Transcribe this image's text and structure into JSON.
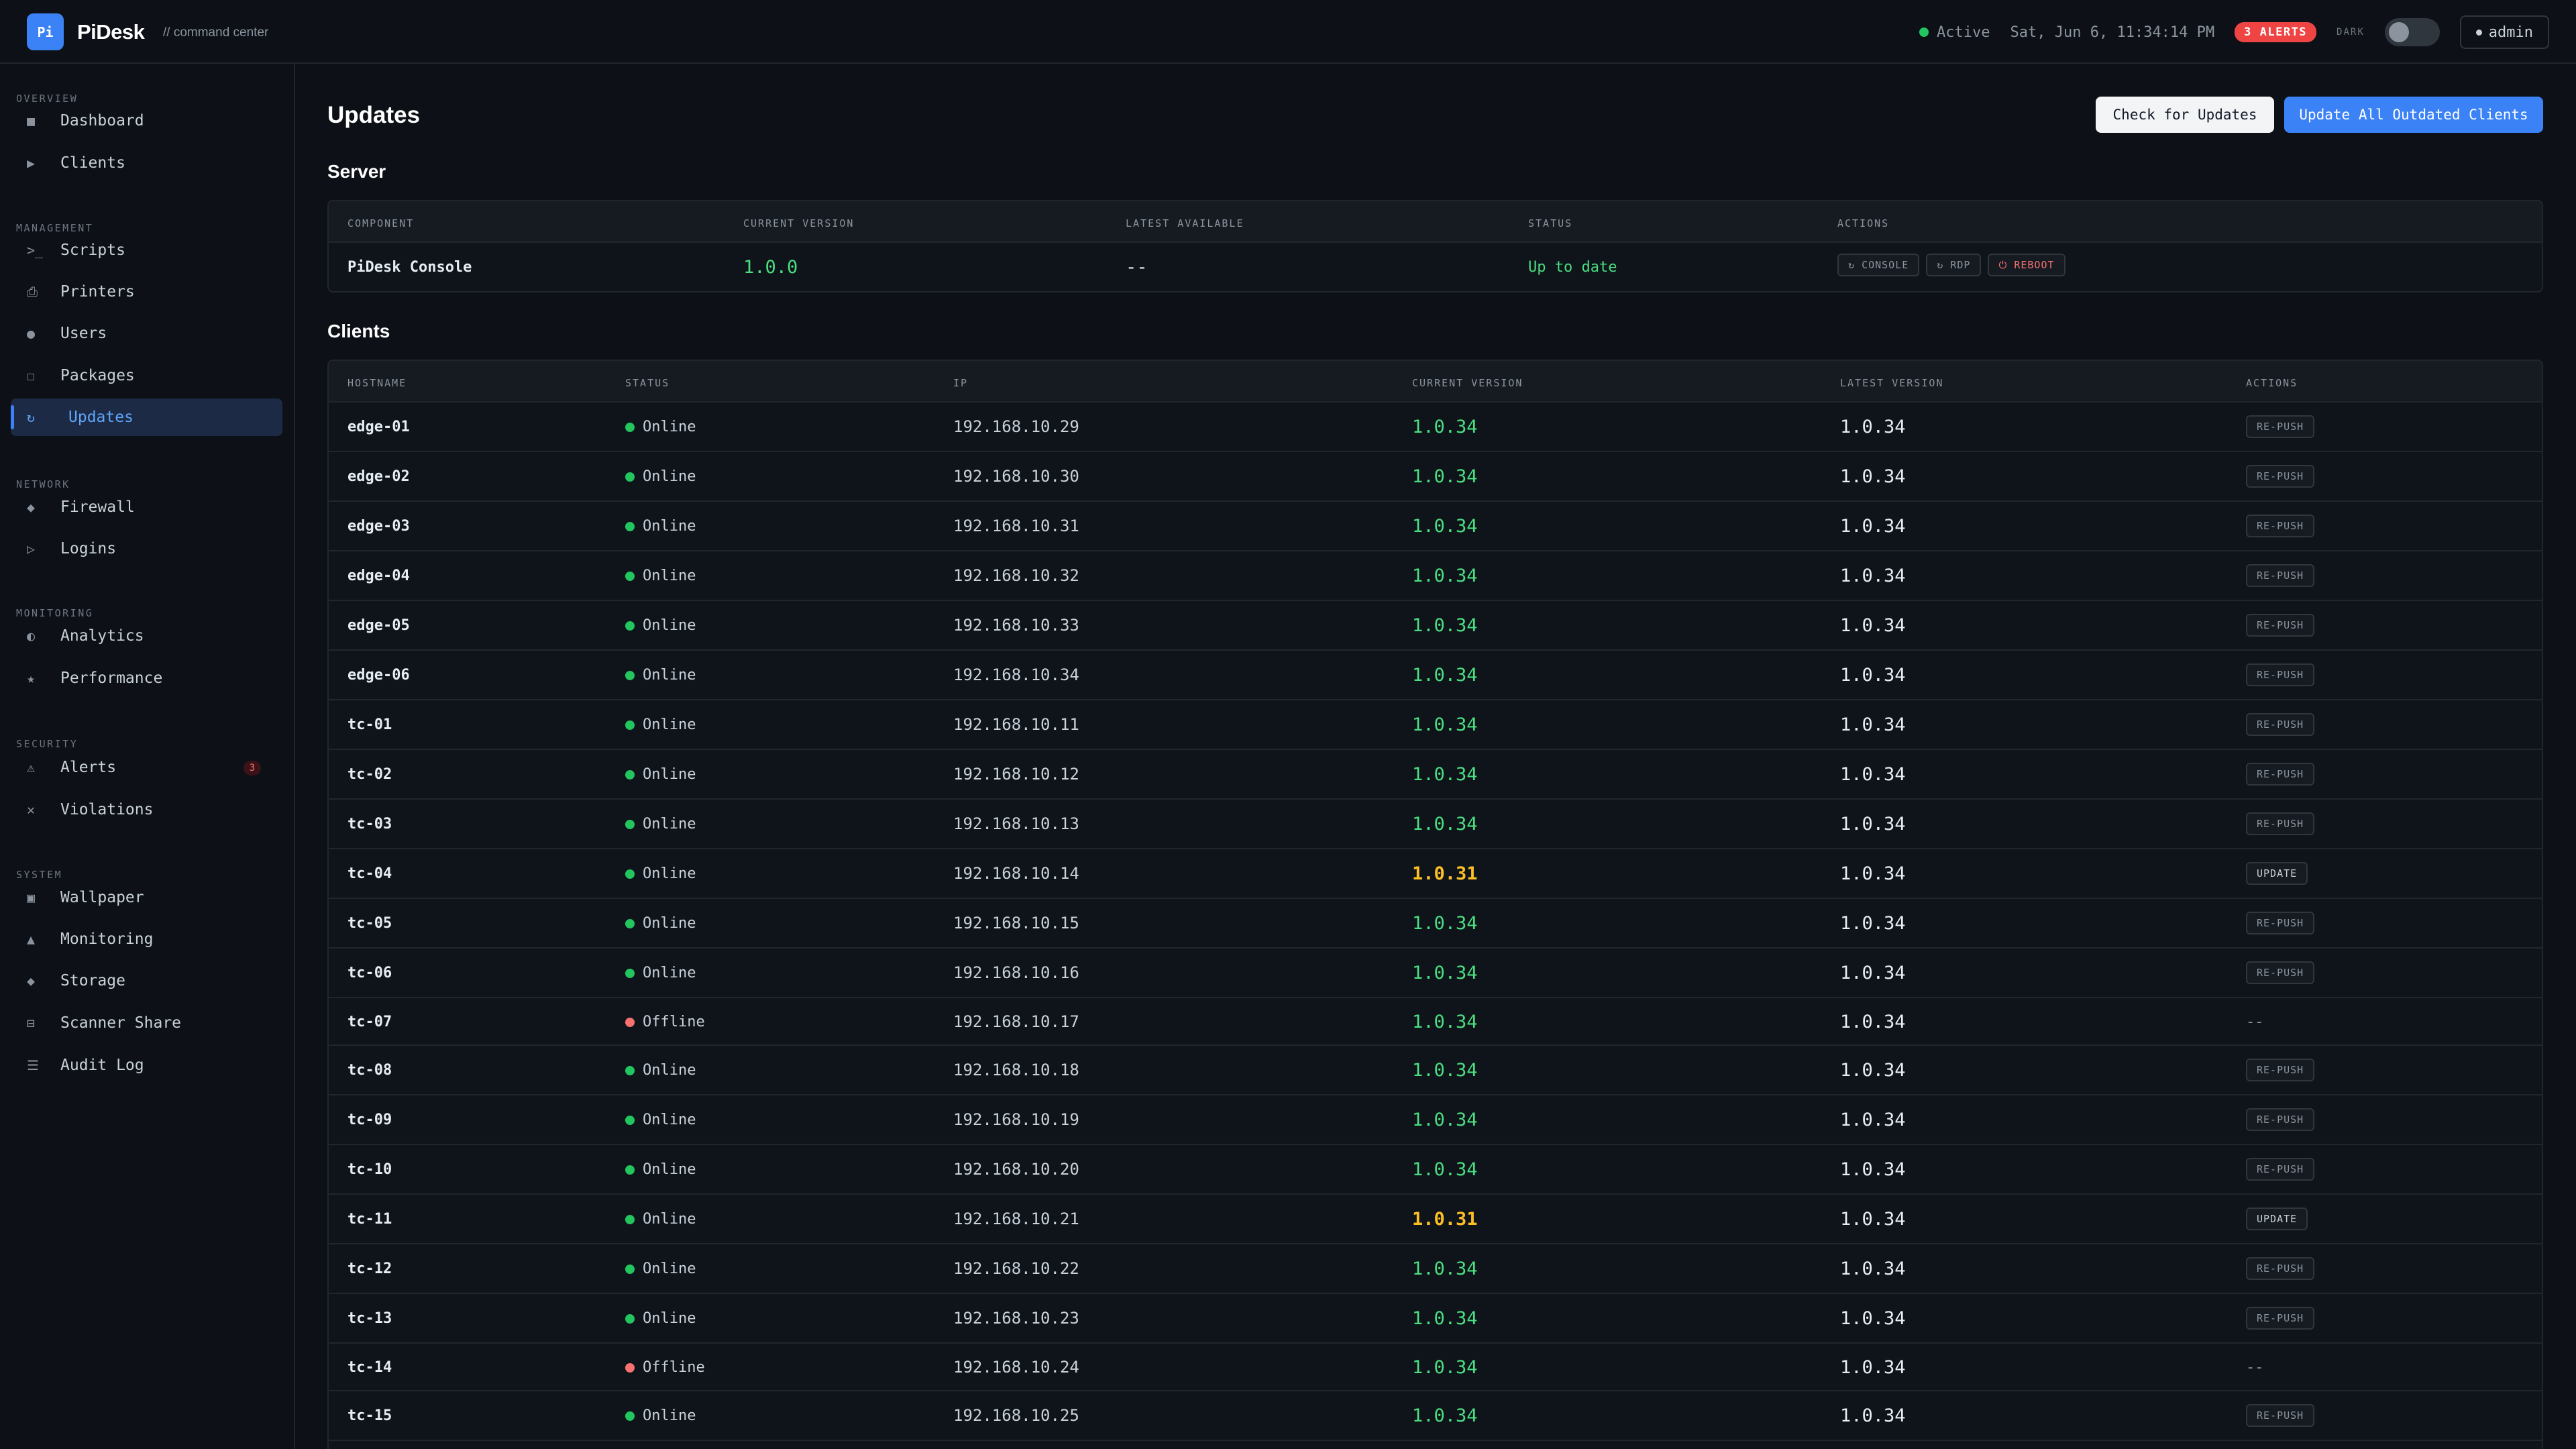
{
  "app": {
    "logo": "Pi",
    "name": "PiDesk",
    "subtitle": "// command center"
  },
  "topbar": {
    "status": "Active",
    "datetime": "Sat, Jun 6, 11:34:14 PM",
    "alerts_badge": "3 ALERTS",
    "theme_label": "DARK",
    "user": "admin"
  },
  "sidebar": {
    "sections": [
      {
        "title": "OVERVIEW",
        "items": [
          {
            "icon": "dashboard-icon",
            "glyph": "■",
            "label": "Dashboard"
          },
          {
            "icon": "clients-icon",
            "glyph": "▶",
            "label": "Clients"
          }
        ]
      },
      {
        "title": "MANAGEMENT",
        "items": [
          {
            "icon": "terminal-icon",
            "glyph": ">_",
            "label": "Scripts"
          },
          {
            "icon": "printer-icon",
            "glyph": "⎙",
            "label": "Printers"
          },
          {
            "icon": "users-icon",
            "glyph": "●",
            "label": "Users"
          },
          {
            "icon": "package-icon",
            "glyph": "☐",
            "label": "Packages"
          },
          {
            "icon": "refresh-icon",
            "glyph": "↻",
            "label": "Updates",
            "active": true
          }
        ]
      },
      {
        "title": "NETWORK",
        "items": [
          {
            "icon": "firewall-icon",
            "glyph": "◆",
            "label": "Firewall"
          },
          {
            "icon": "logins-icon",
            "glyph": "▷",
            "label": "Logins"
          }
        ]
      },
      {
        "title": "MONITORING",
        "items": [
          {
            "icon": "analytics-icon",
            "glyph": "◐",
            "label": "Analytics"
          },
          {
            "icon": "performance-icon",
            "glyph": "★",
            "label": "Performance"
          }
        ]
      },
      {
        "title": "SECURITY",
        "items": [
          {
            "icon": "warning-icon",
            "glyph": "⚠",
            "label": "Alerts",
            "badge": "3"
          },
          {
            "icon": "violations-icon",
            "glyph": "✕",
            "label": "Violations"
          }
        ]
      },
      {
        "title": "SYSTEM",
        "items": [
          {
            "icon": "wallpaper-icon",
            "glyph": "▣",
            "label": "Wallpaper"
          },
          {
            "icon": "monitoring-icon",
            "glyph": "▲",
            "label": "Monitoring"
          },
          {
            "icon": "storage-icon",
            "glyph": "◆",
            "label": "Storage"
          },
          {
            "icon": "scanner-icon",
            "glyph": "⊟",
            "label": "Scanner Share"
          },
          {
            "icon": "audit-log-icon",
            "glyph": "☰",
            "label": "Audit Log"
          }
        ]
      }
    ]
  },
  "page": {
    "title": "Updates",
    "check_button": "Check for Updates",
    "update_all_button": "Update All Outdated Clients"
  },
  "server": {
    "title": "Server",
    "columns": [
      "COMPONENT",
      "CURRENT VERSION",
      "LATEST AVAILABLE",
      "STATUS",
      "ACTIONS"
    ],
    "row": {
      "component": "PiDesk Console",
      "current_version": "1.0.0",
      "latest": "--",
      "status": "Up to date",
      "actions": [
        {
          "icon": "↻",
          "label": "CONSOLE"
        },
        {
          "icon": "↻",
          "label": "RDP"
        },
        {
          "icon": "⏻",
          "label": "REBOOT"
        }
      ]
    }
  },
  "clients": {
    "title": "Clients",
    "columns": [
      "HOSTNAME",
      "STATUS",
      "IP",
      "CURRENT VERSION",
      "LATEST VERSION",
      "ACTIONS"
    ],
    "rows": [
      {
        "hostname": "edge-01",
        "status": "Online",
        "ip": "192.168.10.29",
        "current": "1.0.34",
        "latest": "1.0.34",
        "action": "RE-PUSH"
      },
      {
        "hostname": "edge-02",
        "status": "Online",
        "ip": "192.168.10.30",
        "current": "1.0.34",
        "latest": "1.0.34",
        "action": "RE-PUSH"
      },
      {
        "hostname": "edge-03",
        "status": "Online",
        "ip": "192.168.10.31",
        "current": "1.0.34",
        "latest": "1.0.34",
        "action": "RE-PUSH"
      },
      {
        "hostname": "edge-04",
        "status": "Online",
        "ip": "192.168.10.32",
        "current": "1.0.34",
        "latest": "1.0.34",
        "action": "RE-PUSH"
      },
      {
        "hostname": "edge-05",
        "status": "Online",
        "ip": "192.168.10.33",
        "current": "1.0.34",
        "latest": "1.0.34",
        "action": "RE-PUSH"
      },
      {
        "hostname": "edge-06",
        "status": "Online",
        "ip": "192.168.10.34",
        "current": "1.0.34",
        "latest": "1.0.34",
        "action": "RE-PUSH"
      },
      {
        "hostname": "tc-01",
        "status": "Online",
        "ip": "192.168.10.11",
        "current": "1.0.34",
        "latest": "1.0.34",
        "action": "RE-PUSH"
      },
      {
        "hostname": "tc-02",
        "status": "Online",
        "ip": "192.168.10.12",
        "current": "1.0.34",
        "latest": "1.0.34",
        "action": "RE-PUSH"
      },
      {
        "hostname": "tc-03",
        "status": "Online",
        "ip": "192.168.10.13",
        "current": "1.0.34",
        "latest": "1.0.34",
        "action": "RE-PUSH"
      },
      {
        "hostname": "tc-04",
        "status": "Online",
        "ip": "192.168.10.14",
        "current": "1.0.31",
        "latest": "1.0.34",
        "action": "UPDATE",
        "outdated": true
      },
      {
        "hostname": "tc-05",
        "status": "Online",
        "ip": "192.168.10.15",
        "current": "1.0.34",
        "latest": "1.0.34",
        "action": "RE-PUSH"
      },
      {
        "hostname": "tc-06",
        "status": "Online",
        "ip": "192.168.10.16",
        "current": "1.0.34",
        "latest": "1.0.34",
        "action": "RE-PUSH"
      },
      {
        "hostname": "tc-07",
        "status": "Offline",
        "ip": "192.168.10.17",
        "current": "1.0.34",
        "latest": "1.0.34",
        "action": "--"
      },
      {
        "hostname": "tc-08",
        "status": "Online",
        "ip": "192.168.10.18",
        "current": "1.0.34",
        "latest": "1.0.34",
        "action": "RE-PUSH"
      },
      {
        "hostname": "tc-09",
        "status": "Online",
        "ip": "192.168.10.19",
        "current": "1.0.34",
        "latest": "1.0.34",
        "action": "RE-PUSH"
      },
      {
        "hostname": "tc-10",
        "status": "Online",
        "ip": "192.168.10.20",
        "current": "1.0.34",
        "latest": "1.0.34",
        "action": "RE-PUSH"
      },
      {
        "hostname": "tc-11",
        "status": "Online",
        "ip": "192.168.10.21",
        "current": "1.0.31",
        "latest": "1.0.34",
        "action": "UPDATE",
        "outdated": true
      },
      {
        "hostname": "tc-12",
        "status": "Online",
        "ip": "192.168.10.22",
        "current": "1.0.34",
        "latest": "1.0.34",
        "action": "RE-PUSH"
      },
      {
        "hostname": "tc-13",
        "status": "Online",
        "ip": "192.168.10.23",
        "current": "1.0.34",
        "latest": "1.0.34",
        "action": "RE-PUSH"
      },
      {
        "hostname": "tc-14",
        "status": "Offline",
        "ip": "192.168.10.24",
        "current": "1.0.34",
        "latest": "1.0.34",
        "action": "--"
      },
      {
        "hostname": "tc-15",
        "status": "Online",
        "ip": "192.168.10.25",
        "current": "1.0.34",
        "latest": "1.0.34",
        "action": "RE-PUSH"
      }
    ]
  },
  "colors": {
    "accent": "#3b82f6",
    "online": "#22c55e",
    "offline": "#f87171",
    "up_to_date_version": "#4ade80",
    "outdated_version": "#fbbf24",
    "alert": "#ef4444"
  }
}
